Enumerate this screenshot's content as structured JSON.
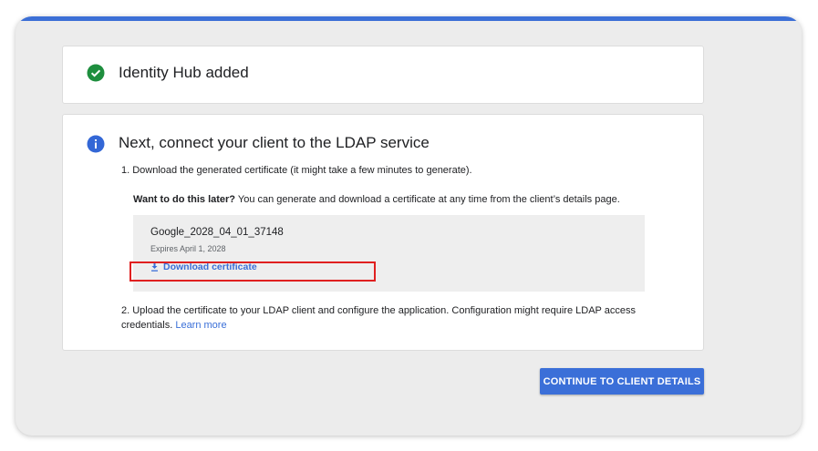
{
  "colors": {
    "accent": "#3b6fd8",
    "success": "#1e8e3e",
    "info": "#3367d6",
    "highlight": "#e02020"
  },
  "added_card": {
    "icon": "check-circle-icon",
    "title": "Identity Hub added"
  },
  "next_card": {
    "icon": "info-icon",
    "title": "Next, connect your client to the LDAP service",
    "step1": "1. Download the generated certificate (it might take a few minutes to generate).",
    "later_bold": "Want to do this later?",
    "later_rest": " You can generate and download a certificate at any time from the client’s details page.",
    "certificate": {
      "name": "Google_2028_04_01_37148",
      "expires": "Expires  April 1, 2028",
      "download_icon": "download-icon",
      "download_label": "Download certificate"
    },
    "step2": "2. Upload the certificate to your LDAP client and configure the application. Configuration might require LDAP access credentials.",
    "learn_more": "Learn more"
  },
  "continue_button": "CONTINUE TO CLIENT DETAILS"
}
